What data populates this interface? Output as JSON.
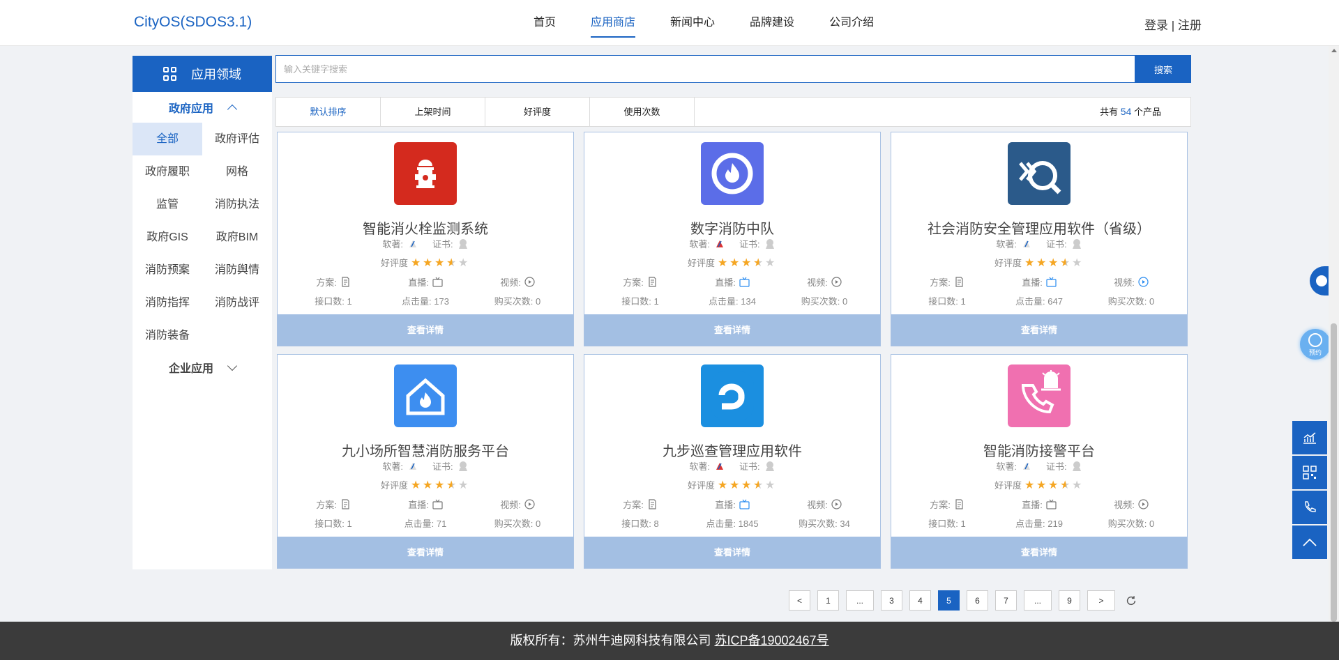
{
  "header": {
    "logo": "CityOS(SDOS3.1)",
    "nav": [
      "首页",
      "应用商店",
      "新闻中心",
      "品牌建设",
      "公司介绍"
    ],
    "active_nav": "应用商店",
    "login": "登录",
    "separator": " | ",
    "register": "注册"
  },
  "sidebar": {
    "heading": "应用领域",
    "group1": "政府应用",
    "categories": [
      "全部",
      "政府评估",
      "政府履职",
      "网格",
      "监管",
      "消防执法",
      "政府GIS",
      "政府BIM",
      "消防预案",
      "消防舆情",
      "消防指挥",
      "消防战评",
      "消防装备"
    ],
    "active_category": "全部",
    "group2": "企业应用"
  },
  "search": {
    "placeholder": "输入关键字搜索",
    "button": "搜索"
  },
  "sort": {
    "options": [
      "默认排序",
      "上架时间",
      "好评度",
      "使用次数"
    ],
    "active": "默认排序",
    "total_prefix": "共有 ",
    "total": "54",
    "total_suffix": " 个产品"
  },
  "labels": {
    "soft": "软著:",
    "cert": "证书:",
    "rating": "好评度",
    "plan": "方案:",
    "live": "直播:",
    "video": "视频:",
    "api": "接口数:",
    "clicks": "点击量:",
    "buys": "购买次数:",
    "detail": "查看详情"
  },
  "products": [
    {
      "title": "智能消火栓监测系统",
      "icon": "fire-hydrant-icon",
      "color": "#d42a1e",
      "rating": 3.5,
      "api": "1",
      "clicks": "173",
      "buys": "0"
    },
    {
      "title": "数字消防中队",
      "icon": "fire-brigade-icon",
      "color": "#5b6de8",
      "rating": 3.5,
      "api": "1",
      "clicks": "134",
      "buys": "0"
    },
    {
      "title": "社会消防安全管理应用软件（省级）",
      "icon": "social-fire-safety-icon",
      "color": "#2b5a8a",
      "rating": 3.5,
      "api": "1",
      "clicks": "647",
      "buys": "0"
    },
    {
      "title": "九小场所智慧消防服务平台",
      "icon": "house-fire-icon",
      "color": "#3d8ef0",
      "rating": 3.5,
      "api": "1",
      "clicks": "71",
      "buys": "0"
    },
    {
      "title": "九步巡查管理应用软件",
      "icon": "nine-step-icon",
      "color": "#1b8fe0",
      "rating": 3.5,
      "api": "8",
      "clicks": "1845",
      "buys": "34"
    },
    {
      "title": "智能消防接警平台",
      "icon": "alarm-call-icon",
      "color": "#f070b0",
      "rating": 3.5,
      "api": "1",
      "clicks": "219",
      "buys": "0"
    }
  ],
  "pagination": {
    "prev": "<",
    "pages": [
      "1",
      "...",
      "3",
      "4",
      "5",
      "6",
      "7",
      "...",
      "9"
    ],
    "current": "5",
    "next": ">"
  },
  "footer": {
    "copyright": "版权所有：苏州牛迪网科技有限公司 ",
    "icp": "苏ICP备19002467号"
  },
  "float": {
    "appointment": "预约"
  }
}
